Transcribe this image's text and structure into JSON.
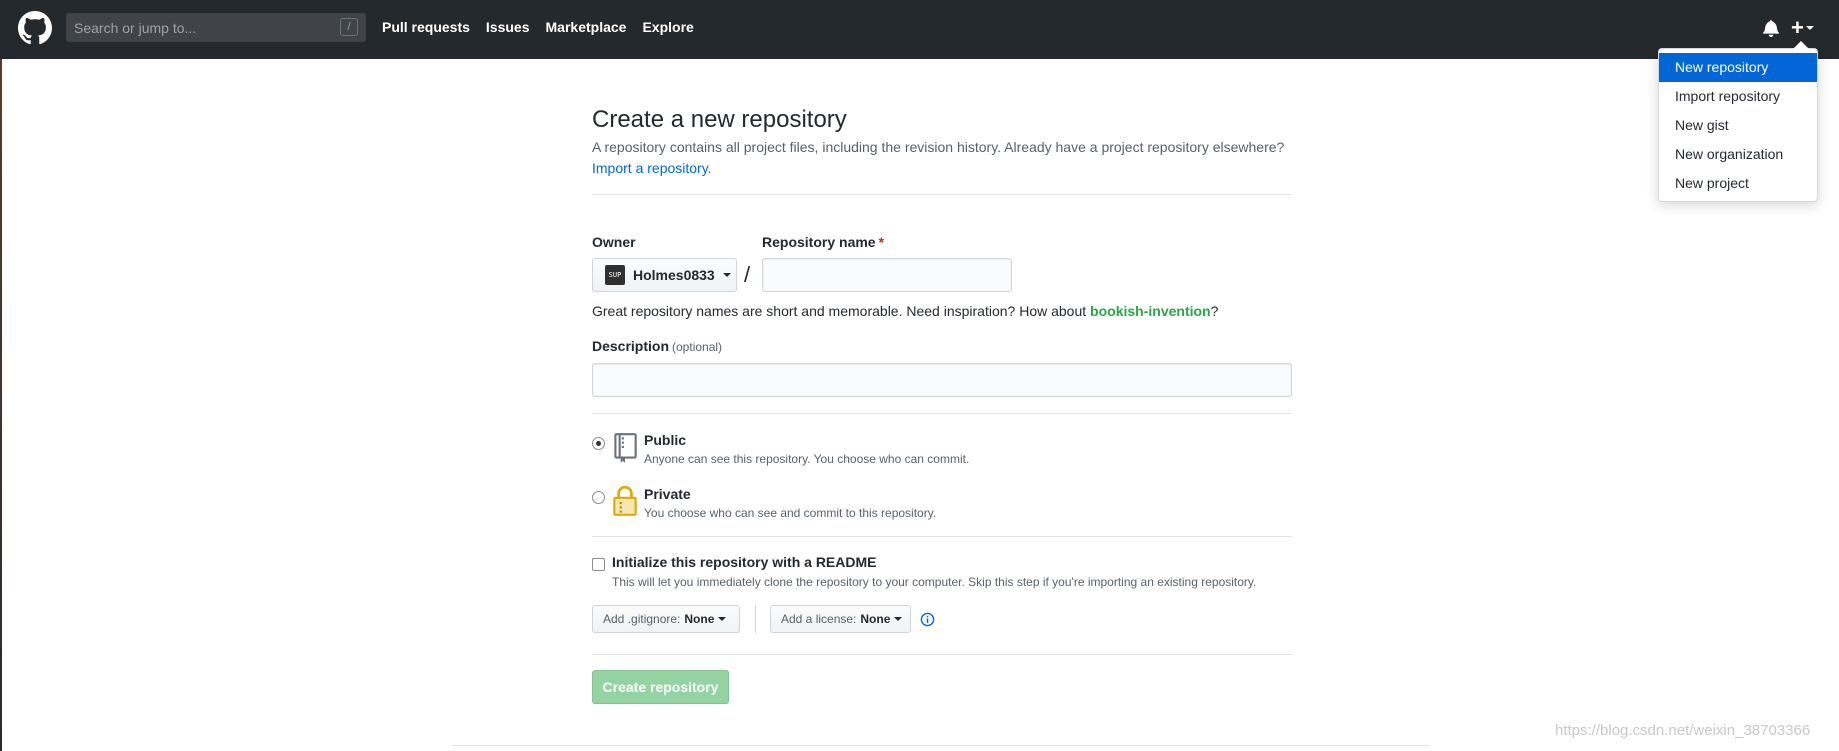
{
  "header": {
    "search_placeholder": "Search or jump to...",
    "search_key": "/",
    "nav": [
      "Pull requests",
      "Issues",
      "Marketplace",
      "Explore"
    ],
    "plus_label": "+"
  },
  "dropdown": {
    "items": [
      "New repository",
      "Import repository",
      "New gist",
      "New organization",
      "New project"
    ],
    "active_index": 0
  },
  "form": {
    "title": "Create a new repository",
    "description": "A repository contains all project files, including the revision history. Already have a project repository elsewhere?",
    "import_link": "Import a repository.",
    "owner_label": "Owner",
    "owner_value": "Holmes0833",
    "owner_avatar_text": "SUP",
    "slash": "/",
    "repo_name_label": "Repository name",
    "required_mark": "*",
    "repo_name_value": "",
    "hint_prefix": "Great repository names are short and memorable. Need inspiration? How about ",
    "hint_suggestion": "bookish-invention",
    "hint_suffix": "?",
    "description_label": "Description",
    "optional_label": "(optional)",
    "description_value": "",
    "public_title": "Public",
    "public_note": "Anyone can see this repository. You choose who can commit.",
    "private_title": "Private",
    "private_note": "You choose who can see and commit to this repository.",
    "init_title": "Initialize this repository with a README",
    "init_note": "This will let you immediately clone the repository to your computer. Skip this step if you're importing an existing repository.",
    "gitignore_label": "Add .gitignore:",
    "gitignore_value": "None",
    "license_label": "Add a license:",
    "license_value": "None",
    "create_button": "Create repository"
  },
  "watermark": "https://blog.csdn.net/weixin_38703366",
  "colors": {
    "header_bg": "#24292e",
    "accent": "#0366d6",
    "create_button_bg": "#94d3a2",
    "suggestion": "#28a745"
  }
}
